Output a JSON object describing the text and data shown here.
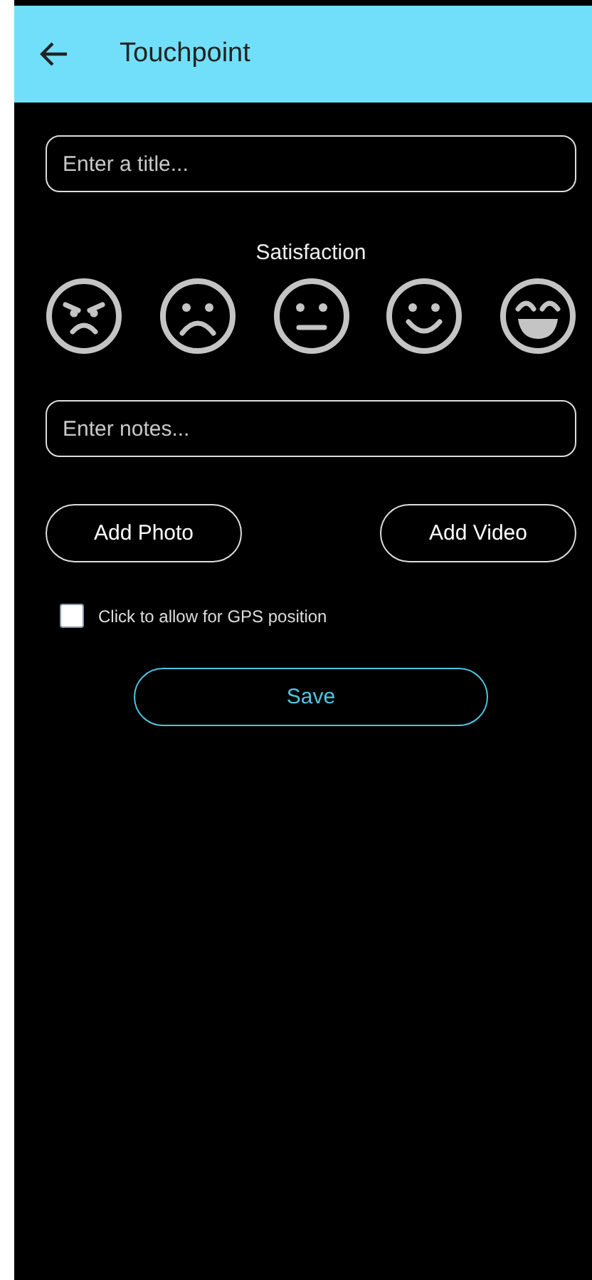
{
  "header": {
    "title": "Touchpoint"
  },
  "title_field": {
    "placeholder": "Enter a title..."
  },
  "satisfaction": {
    "label": "Satisfaction",
    "faces": [
      {
        "kind": "angry"
      },
      {
        "kind": "sad"
      },
      {
        "kind": "neutral"
      },
      {
        "kind": "happy"
      },
      {
        "kind": "laughing"
      }
    ]
  },
  "notes_field": {
    "placeholder": "Enter notes..."
  },
  "media_buttons": [
    "Add Photo",
    "Add Video"
  ],
  "gps": {
    "label": "Click to allow for GPS position",
    "checked": false
  },
  "save_button": "Save"
}
